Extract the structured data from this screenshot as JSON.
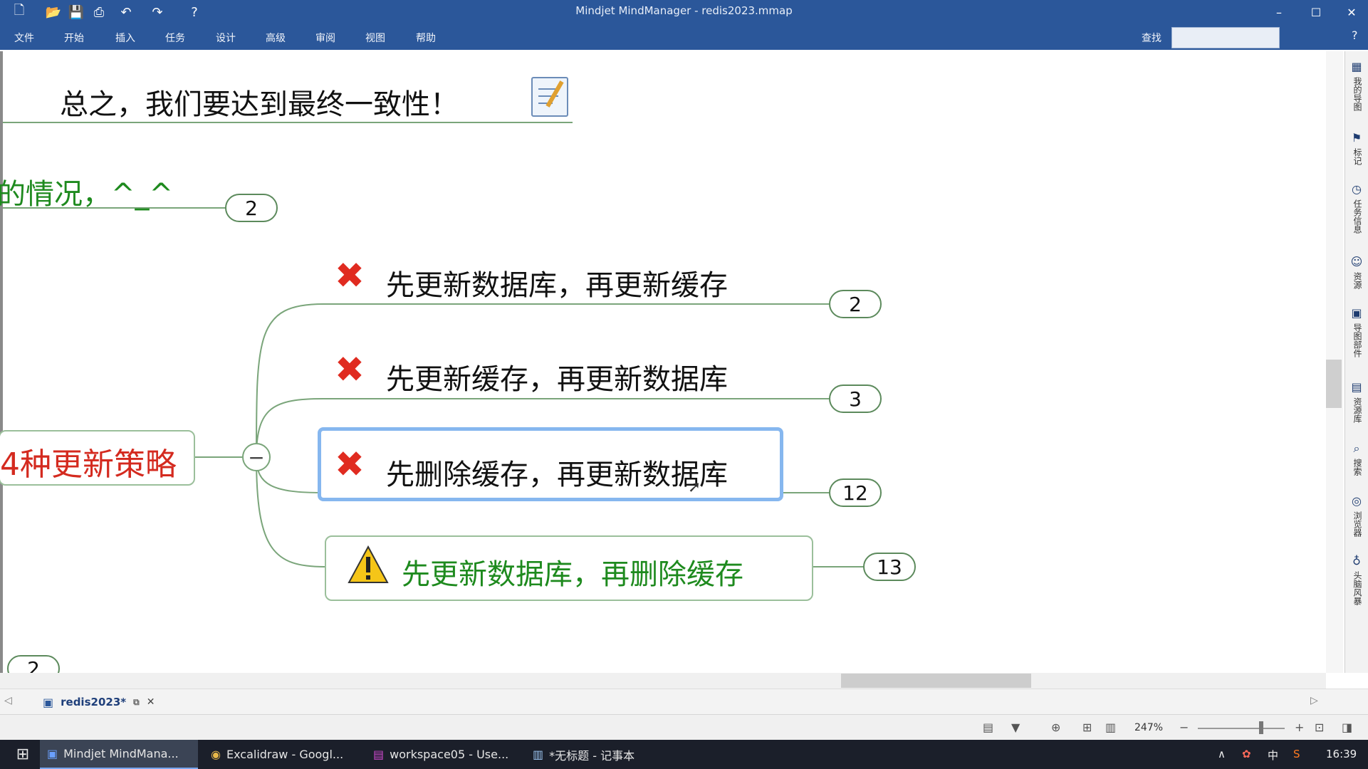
{
  "window": {
    "title": "Mindjet MindManager - redis2023.mmap"
  },
  "menu": {
    "items": [
      "文件",
      "开始",
      "插入",
      "任务",
      "设计",
      "高级",
      "审阅",
      "视图",
      "帮助"
    ],
    "find_label": "查找"
  },
  "map": {
    "top_node": "总之，我们要达到最终一致性！",
    "partial_node": "的情况，^_^",
    "partial_node_count": "2",
    "center_node": "4种更新策略",
    "collapse_symbol": "−",
    "branches": [
      {
        "label": "先更新数据库，再更新缓存",
        "count": "2",
        "icon": "red-x-icon"
      },
      {
        "label": "先更新缓存，再更新数据库",
        "count": "3",
        "icon": "red-x-icon"
      },
      {
        "label": "先删除缓存，再更新数据库",
        "count": "12",
        "icon": "red-x-icon"
      },
      {
        "label": "先更新数据库，再删除缓存",
        "count": "13",
        "icon": "warning-icon"
      }
    ],
    "bottom_count": "2"
  },
  "right_panel": {
    "items": [
      "我的导图",
      "标记",
      "任务信息",
      "资源",
      "导图部件",
      "资源库",
      "搜索",
      "浏览器",
      "头脑风暴"
    ]
  },
  "doc_tab": {
    "name": "redis2023*"
  },
  "status": {
    "zoom": "247%"
  },
  "taskbar": {
    "apps": [
      {
        "label": "Mindjet MindMana..."
      },
      {
        "label": "Excalidraw - Googl..."
      },
      {
        "label": "workspace05 - Use..."
      },
      {
        "label": "*无标题 - 记事本"
      }
    ],
    "ime": "中",
    "time": "16:39"
  },
  "colors": {
    "accent": "#2b579a",
    "branch_line": "#7aa57a",
    "red": "#d42a1f",
    "green": "#1e8a1e"
  }
}
